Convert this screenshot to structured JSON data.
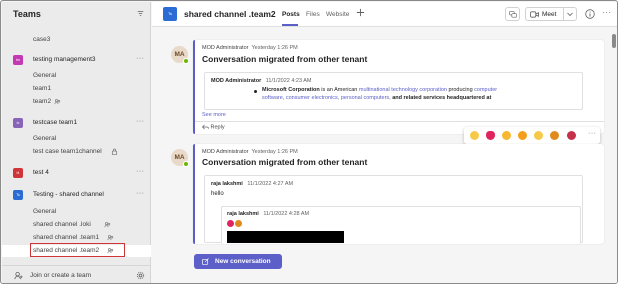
{
  "colors": {
    "accent": "#5b5fc7",
    "highlight": "#d13438",
    "presence": "#6bb700",
    "channel_tile": "#2b6cd4"
  },
  "sidebar": {
    "title": "Teams",
    "filter_icon": "filter-icon",
    "rows": [
      {
        "kind": "channel",
        "label": "case3"
      },
      {
        "kind": "team",
        "label": "testing management3",
        "initials": "tm",
        "color": "#c239b3"
      },
      {
        "kind": "channel",
        "label": "General"
      },
      {
        "kind": "channel",
        "label": "team1"
      },
      {
        "kind": "channel",
        "label": "team2",
        "icon": "shared-channel-icon"
      },
      {
        "kind": "team",
        "label": "testcase team1",
        "initials": "tc",
        "color": "#8764b8"
      },
      {
        "kind": "channel",
        "label": "General"
      },
      {
        "kind": "channel",
        "label": "test case team1channel",
        "icon": "lock-icon"
      },
      {
        "kind": "team",
        "label": "test 4",
        "initials": "t4",
        "color": "#d13438"
      },
      {
        "kind": "team",
        "label": "Testing - shared channel",
        "initials": "Ts",
        "color": "#2b6cd4"
      },
      {
        "kind": "channel",
        "label": "General"
      },
      {
        "kind": "channel",
        "label": "shared channel .loki",
        "icon": "shared-channel-icon"
      },
      {
        "kind": "channel",
        "label": "shared channel .team1",
        "icon": "shared-channel-icon"
      },
      {
        "kind": "channel",
        "label": "shared channel .team2",
        "icon": "shared-channel-icon",
        "selected": true
      }
    ],
    "footer": {
      "join_label": "Join or create a team"
    }
  },
  "header": {
    "channel_initials": "Ts",
    "channel_name": "shared channel .team2",
    "tabs": [
      {
        "label": "Posts",
        "active": true
      },
      {
        "label": "Files",
        "active": false
      },
      {
        "label": "Website",
        "active": false
      }
    ],
    "meet_label": "Meet"
  },
  "posts": [
    {
      "avatar": "MA",
      "author": "MOD Administrator",
      "time": "Yesterday 1:26 PM",
      "subject": "Conversation migrated from other tenant",
      "quoted": {
        "author": "MOD Administrator",
        "time": "11/1/2022 4:23 AM",
        "line1": {
          "bold_start": "Microsoft Corporation",
          "mid": " is an American ",
          "link1": "multinational technology corporation",
          "mid2": " producing ",
          "link2": "computer"
        },
        "line2": {
          "link3": "software, consumer electronics, personal computers,",
          "bold_end": " and related services headquartered at"
        }
      },
      "see_more": "See more",
      "reply": "Reply"
    },
    {
      "avatar": "MA",
      "author": "MOD Administrator",
      "time": "Yesterday 1:26 PM",
      "subject": "Conversation migrated from other tenant",
      "quoted": {
        "author": "raja lakshmi",
        "time": "11/1/2022 4:27 AM",
        "body": "hello"
      },
      "nested": {
        "author": "raja lakshmi",
        "time": "11/1/2022 4:28 AM"
      }
    }
  ],
  "reactions": [
    "thumbs-up-icon",
    "heart-icon",
    "laugh-icon",
    "surprised-icon",
    "sad-icon",
    "angry-icon",
    "custom-emoji-icon"
  ],
  "compose": {
    "label": "New conversation"
  }
}
